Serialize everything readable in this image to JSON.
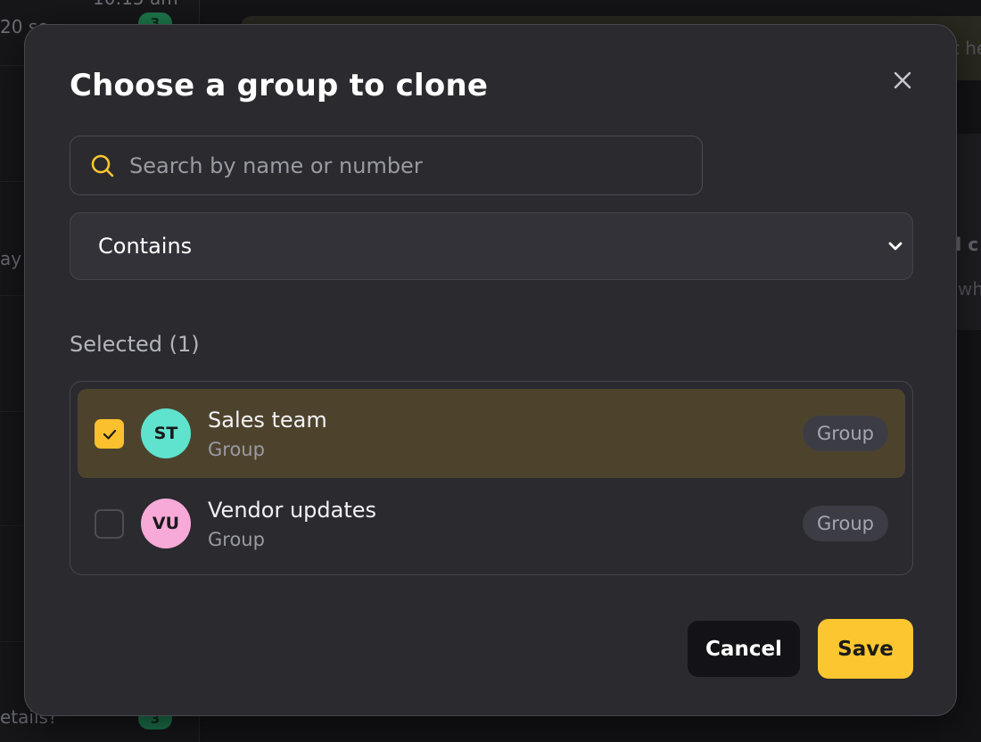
{
  "background": {
    "snippets": [
      "10:15 am",
      "20 se",
      "ay",
      "etails?"
    ],
    "badges": [
      "3",
      "3"
    ],
    "right_text": [
      "t he",
      "d c",
      "wh"
    ]
  },
  "modal": {
    "title": "Choose a group to clone",
    "close_icon": "close-icon",
    "search": {
      "placeholder": "Search by name or number",
      "value": "",
      "icon": "search-icon"
    },
    "filter": {
      "selected": "Contains",
      "icon": "chevron-down-icon"
    },
    "selected_heading": "Selected (1)",
    "items": [
      {
        "name": "Sales team",
        "subtitle": "Group",
        "initials": "ST",
        "tag": "Group",
        "checked": true,
        "avatar_color": "#5fe3cf"
      },
      {
        "name": "Vendor updates",
        "subtitle": "Group",
        "initials": "VU",
        "tag": "Group",
        "checked": false,
        "avatar_color": "#f7a9d8"
      }
    ],
    "actions": {
      "cancel_label": "Cancel",
      "save_label": "Save"
    },
    "colors": {
      "accent": "#fbc630",
      "selected_row": "#4d432d",
      "modal_bg": "#2a2a2f"
    }
  }
}
